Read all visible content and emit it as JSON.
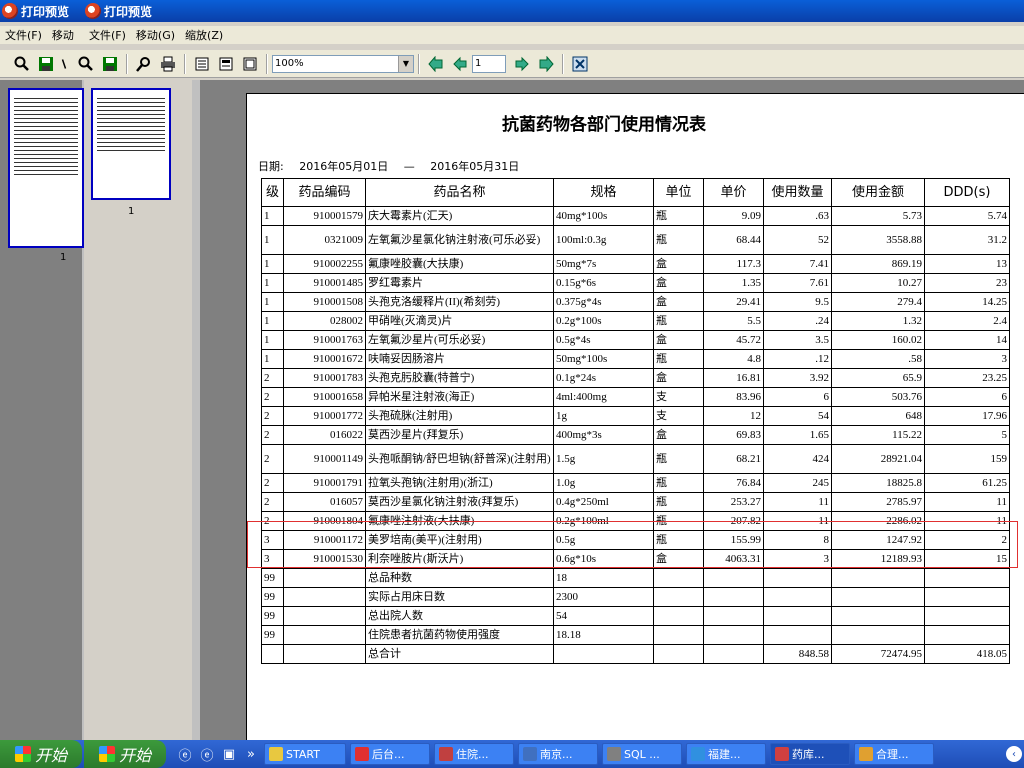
{
  "windows": [
    {
      "title": "打印预览"
    },
    {
      "title": "打印预览"
    }
  ],
  "menu1": [
    "文件(F)",
    "移动"
  ],
  "menu2": [
    "文件(F)",
    "移动(G)",
    "缩放(Z)"
  ],
  "toolbar": {
    "zoom": "100%",
    "page": "1"
  },
  "thumbs": [
    {
      "label": "1"
    },
    {
      "label": "1"
    }
  ],
  "report": {
    "title": "抗菌药物各部门使用情况表",
    "date_label": "日期:",
    "date_from": "2016年05月01日",
    "date_sep": "—",
    "date_to": "2016年05月31日",
    "headers": [
      "级",
      "药品编码",
      "药品名称",
      "规格",
      "单位",
      "单价",
      "使用数量",
      "使用金额",
      "DDD(s)"
    ],
    "rows": [
      [
        "1",
        "910001579",
        "庆大霉素片(汇天)",
        "40mg*100s",
        "瓶",
        "9.09",
        ".63",
        "5.73",
        "5.74"
      ],
      [
        "1",
        "0321009",
        "左氧氟沙星氯化钠注射液(可乐必妥)",
        "100ml:0.3g",
        "瓶",
        "68.44",
        "52",
        "3558.88",
        "31.2"
      ],
      [
        "1",
        "910002255",
        "氟康唑胶囊(大扶康)",
        "50mg*7s",
        "盒",
        "117.3",
        "7.41",
        "869.19",
        "13"
      ],
      [
        "1",
        "910001485",
        "罗红霉素片",
        "0.15g*6s",
        "盒",
        "1.35",
        "7.61",
        "10.27",
        "23"
      ],
      [
        "1",
        "910001508",
        "头孢克洛缓释片(II)(希刻劳)",
        "0.375g*4s",
        "盒",
        "29.41",
        "9.5",
        "279.4",
        "14.25"
      ],
      [
        "1",
        "028002",
        "甲硝唑(灭滴灵)片",
        "0.2g*100s",
        "瓶",
        "5.5",
        ".24",
        "1.32",
        "2.4"
      ],
      [
        "1",
        "910001763",
        "左氧氟沙星片(可乐必妥)",
        "0.5g*4s",
        "盒",
        "45.72",
        "3.5",
        "160.02",
        "14"
      ],
      [
        "1",
        "910001672",
        "呋喃妥因肠溶片",
        "50mg*100s",
        "瓶",
        "4.8",
        ".12",
        ".58",
        "3"
      ],
      [
        "2",
        "910001783",
        "头孢克肟胶囊(特普宁)",
        "0.1g*24s",
        "盒",
        "16.81",
        "3.92",
        "65.9",
        "23.25"
      ],
      [
        "2",
        "910001658",
        "异帕米星注射液(海正)",
        "4ml:400mg",
        "支",
        "83.96",
        "6",
        "503.76",
        "6"
      ],
      [
        "2",
        "910001772",
        "头孢硫脒(注射用)",
        "1g",
        "支",
        "12",
        "54",
        "648",
        "17.96"
      ],
      [
        "2",
        "016022",
        "莫西沙星片(拜复乐)",
        "400mg*3s",
        "盒",
        "69.83",
        "1.65",
        "115.22",
        "5"
      ],
      [
        "2",
        "910001149",
        "头孢哌酮钠/舒巴坦钠(舒普深)(注射用)",
        "1.5g",
        "瓶",
        "68.21",
        "424",
        "28921.04",
        "159"
      ],
      [
        "2",
        "910001791",
        "拉氧头孢钠(注射用)(浙江)",
        "1.0g",
        "瓶",
        "76.84",
        "245",
        "18825.8",
        "61.25"
      ],
      [
        "2",
        "016057",
        "莫西沙星氯化钠注射液(拜复乐)",
        "0.4g*250ml",
        "瓶",
        "253.27",
        "11",
        "2785.97",
        "11"
      ],
      [
        "2",
        "910001804",
        "氟康唑注射液(大扶康)",
        "0.2g*100ml",
        "瓶",
        "207.82",
        "11",
        "2286.02",
        "11"
      ],
      [
        "3",
        "910001172",
        "美罗培南(美平)(注射用)",
        "0.5g",
        "瓶",
        "155.99",
        "8",
        "1247.92",
        "2"
      ],
      [
        "3",
        "910001530",
        "利奈唑胺片(斯沃片)",
        "0.6g*10s",
        "盒",
        "4063.31",
        "3",
        "12189.93",
        "15"
      ],
      [
        "99",
        "",
        "总品种数",
        "18",
        "",
        "",
        "",
        "",
        ""
      ],
      [
        "99",
        "",
        "实际占用床日数",
        "2300",
        "",
        "",
        "",
        "",
        ""
      ],
      [
        "99",
        "",
        "总出院人数",
        "54",
        "",
        "",
        "",
        "",
        ""
      ],
      [
        "99",
        "",
        "住院患者抗菌药物使用强度",
        "18.18",
        "",
        "",
        "",
        "",
        ""
      ],
      [
        "",
        "",
        "总合计",
        "",
        "",
        "",
        "848.58",
        "72474.95",
        "418.05"
      ]
    ]
  },
  "taskbar": {
    "start1": "开始",
    "start2": "开始",
    "tasks": [
      "START",
      "后台...",
      "住院...",
      "南京...",
      "SQL ...",
      "福建...",
      "药库...",
      "合理..."
    ]
  }
}
